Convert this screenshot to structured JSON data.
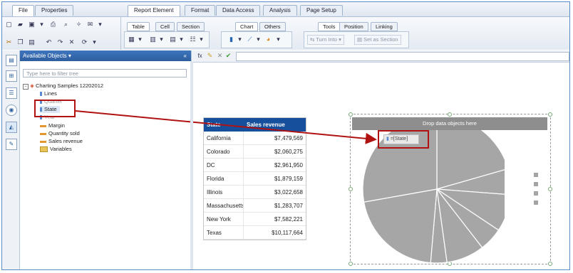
{
  "top_tabs": {
    "file": "File",
    "properties": "Properties",
    "report_element": "Report Element",
    "format": "Format",
    "data_access": "Data Access",
    "analysis": "Analysis",
    "page_setup": "Page Setup"
  },
  "sub_tabs": {
    "table": "Table",
    "cell": "Cell",
    "section": "Section",
    "chart": "Chart",
    "others": "Others",
    "tools": "Tools",
    "position": "Position",
    "linking": "Linking"
  },
  "toolbar": {
    "turn_into": "Turn Into",
    "set_as_section": "Set as Section"
  },
  "panel": {
    "title": "Available Objects",
    "collapse": "«",
    "filter_placeholder": "Type here to filter tree",
    "root": "Charting Samples 12202012",
    "items": [
      "Lines",
      "Quarter",
      "State",
      "Year",
      "Margin",
      "Quantity sold",
      "Sales revenue",
      "Variables"
    ]
  },
  "table": {
    "headers": [
      "State",
      "Sales revenue"
    ],
    "rows": [
      [
        "California",
        "$7,479,569"
      ],
      [
        "Colorado",
        "$2,060,275"
      ],
      [
        "DC",
        "$2,961,950"
      ],
      [
        "Florida",
        "$1,879,159"
      ],
      [
        "Illinois",
        "$3,022,658"
      ],
      [
        "Massachusetts",
        "$1,283,707"
      ],
      [
        "New York",
        "$7,582,221"
      ],
      [
        "Texas",
        "$10,117,664"
      ]
    ]
  },
  "chart": {
    "drop_hint": "Drop data objects here",
    "dragged_object": "=[State]"
  },
  "chart_data": {
    "type": "pie",
    "categories": [
      "California",
      "Colorado",
      "DC",
      "Florida",
      "Illinois",
      "Massachusetts",
      "New York",
      "Texas"
    ],
    "values": [
      7479569,
      2060275,
      2961950,
      1879159,
      3022658,
      1283707,
      7582221,
      10117664
    ],
    "title": "",
    "slice_color": "#a6a6a6"
  },
  "colors": {
    "header_blue": "#16509c",
    "highlight_red": "#b01212",
    "pie_gray": "#a6a6a6"
  }
}
